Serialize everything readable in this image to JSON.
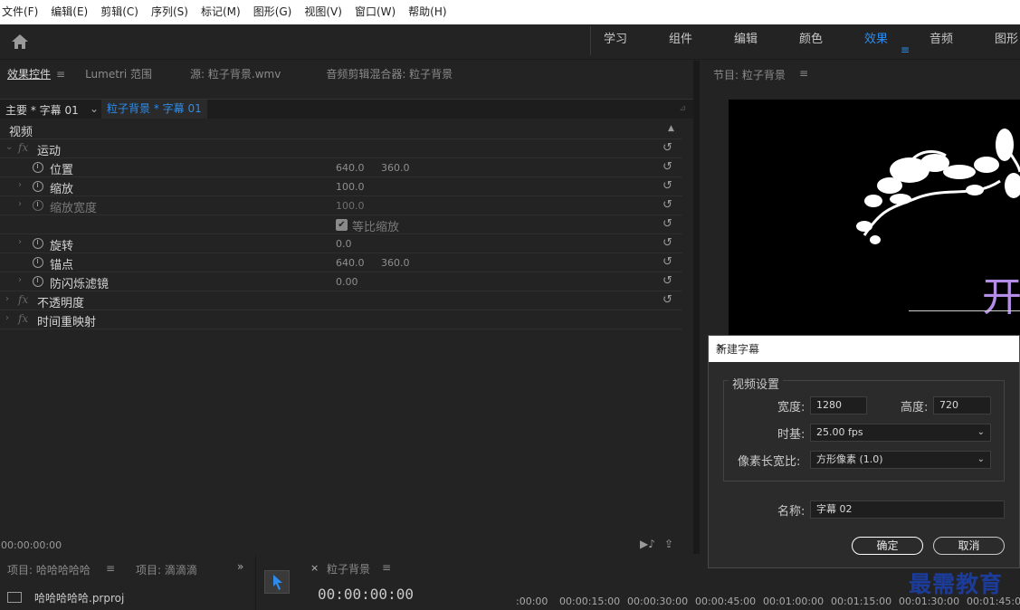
{
  "menu": [
    "文件(F)",
    "编辑(E)",
    "剪辑(C)",
    "序列(S)",
    "标记(M)",
    "图形(G)",
    "视图(V)",
    "窗口(W)",
    "帮助(H)"
  ],
  "workspaces": [
    "学习",
    "组件",
    "编辑",
    "颜色",
    "效果",
    "音频",
    "图形"
  ],
  "active_workspace": "效果",
  "ec_tabs": [
    "效果控件",
    "Lumetri 范围",
    "源: 粒子背景.wmv",
    "音频剪辑混合器: 粒子背景"
  ],
  "clip": {
    "master": "主要 * 字幕 01",
    "sequence": "粒子背景 * 字幕 01"
  },
  "props": {
    "video": "视频",
    "motion": "运动",
    "position": "位置",
    "position_x": "640.0",
    "position_y": "360.0",
    "scale": "缩放",
    "scale_v": "100.0",
    "scale_width": "缩放宽度",
    "scale_width_v": "100.0",
    "uniform": "等比缩放",
    "rotation": "旋转",
    "rotation_v": "0.0",
    "anchor": "锚点",
    "anchor_x": "640.0",
    "anchor_y": "360.0",
    "flicker": "防闪烁滤镜",
    "flicker_v": "0.00",
    "opacity": "不透明度",
    "remap": "时间重映射"
  },
  "ec_timecode": "00:00:00:00",
  "program": {
    "title": "节目: 粒子背景",
    "text": "开"
  },
  "project": {
    "tab": "项目: 哈哈哈哈哈",
    "tab2": "项目: 滴滴滴",
    "file": "哈哈哈哈哈.prproj"
  },
  "timeline": {
    "title": "粒子背景",
    "timecode": "00:00:00:00",
    "ruler": [
      ":00:00",
      "00:00:15:00",
      "00:00:30:00",
      "00:00:45:00",
      "00:01:00:00",
      "00:01:15:00",
      "00:01:30:00",
      "00:01:45:00"
    ]
  },
  "dialog": {
    "title": "新建字幕",
    "group": "视频设置",
    "width_label": "宽度:",
    "width": "1280",
    "height_label": "高度:",
    "height": "720",
    "timebase_label": "时基:",
    "timebase": "25.00 fps",
    "par_label": "像素长宽比:",
    "par": "方形像素 (1.0)",
    "name_label": "名称:",
    "name": "字幕 02",
    "ok": "确定",
    "cancel": "取消"
  },
  "watermark": "最需教育",
  "colors": {
    "accent": "#2d8ceb",
    "title_text": "#b48ee6"
  }
}
